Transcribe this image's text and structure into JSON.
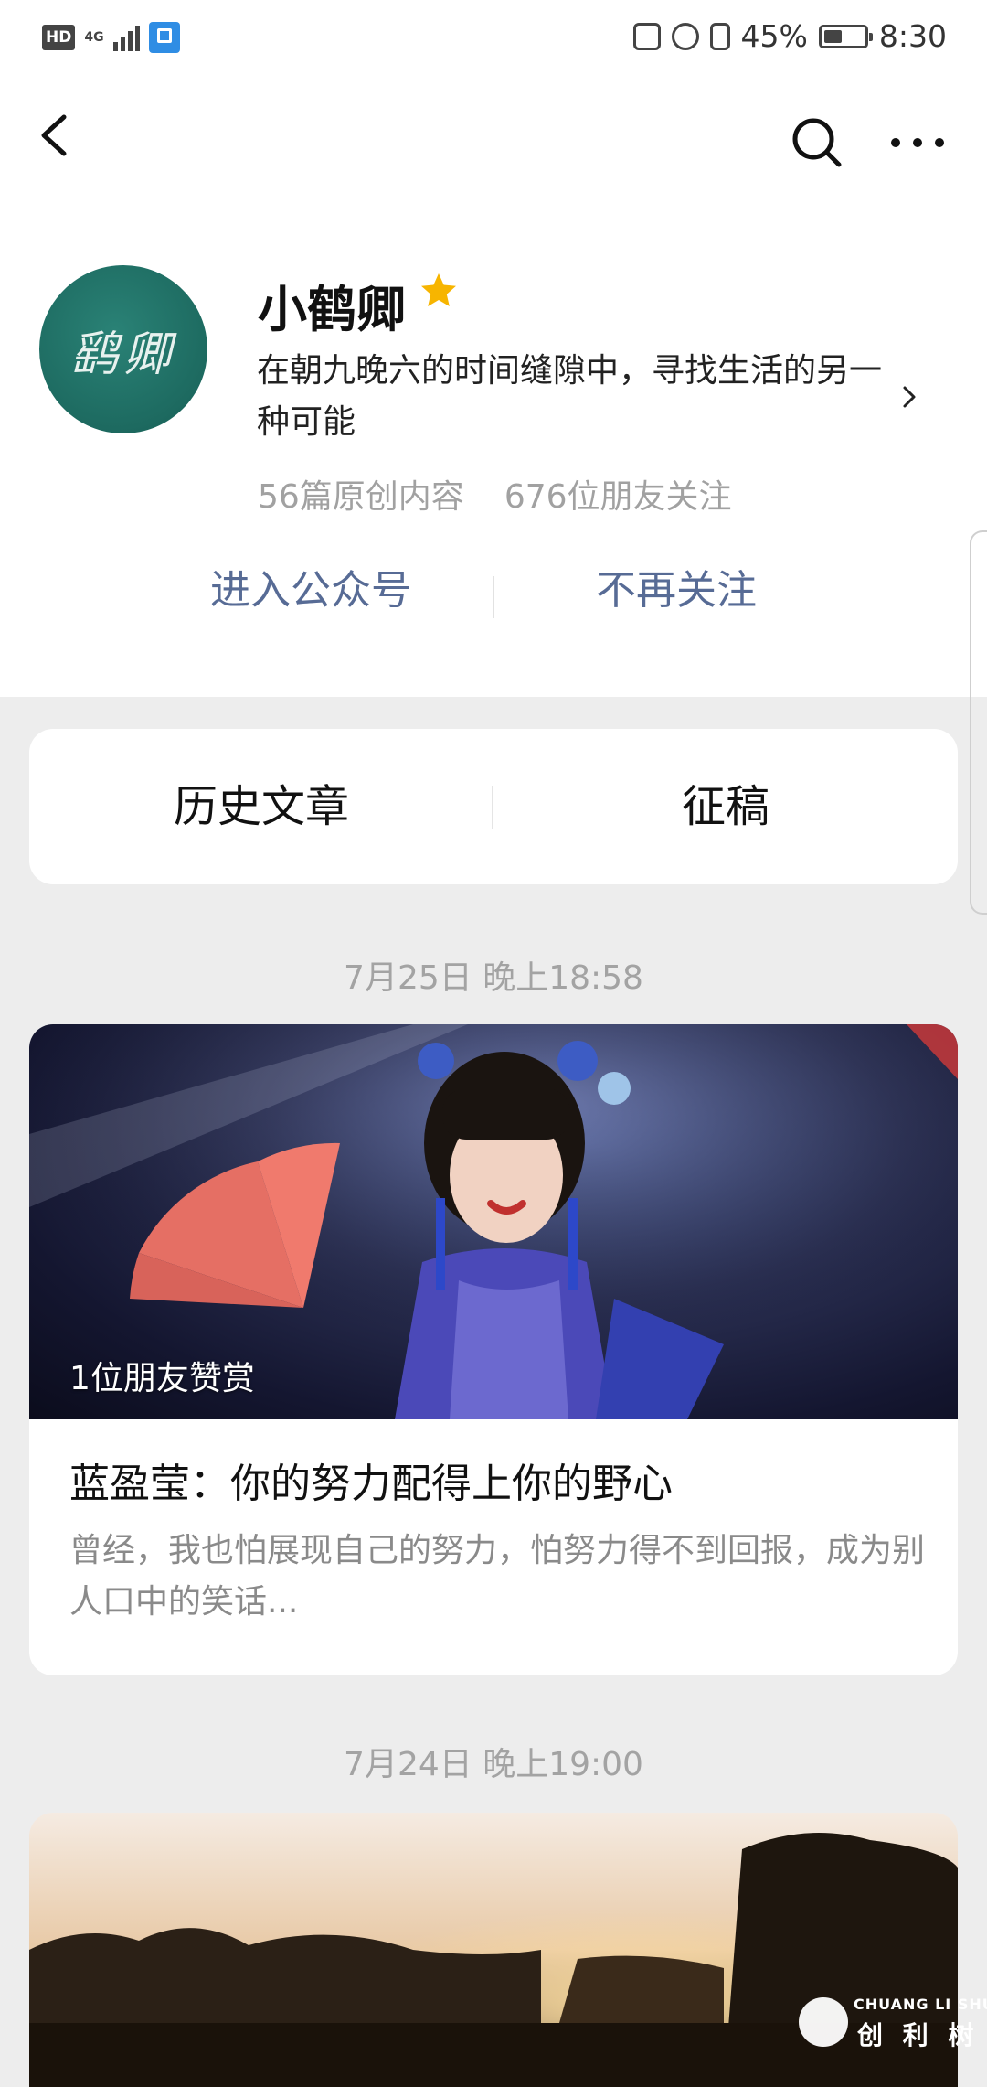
{
  "status_bar": {
    "hd_badge": "HD",
    "network": "4G",
    "battery_percent": "45%",
    "battery_level": 0.45,
    "time": "8:30"
  },
  "nav": {
    "back_icon": "chevron-left-icon",
    "search_icon": "search-icon",
    "more_icon": "more-horizontal-icon"
  },
  "profile": {
    "avatar_text": "鹞卿",
    "name": "小鹤卿",
    "star_color": "#f7b500",
    "description": "在朝九晚六的时间缝隙中，寻找生活的另一种可能",
    "original_count": "56篇原创内容",
    "followers": "676位朋友关注",
    "accent_color": "#576b95"
  },
  "actions": {
    "enter": "进入公众号",
    "unfollow": "不再关注"
  },
  "tabs": {
    "history": "历史文章",
    "submit": "征稿"
  },
  "feed": [
    {
      "date": "7月25日 晚上18:58",
      "cover_label": "1位朋友赞赏",
      "title": "蓝盈莹：你的努力配得上你的野心",
      "summary": "曾经，我也怕展现自己的努力，怕努力得不到回报，成为别人口中的笑话..."
    },
    {
      "date": "7月24日 晚上19:00"
    }
  ],
  "watermark": {
    "en": "CHUANG LI SHU",
    "cn": "创 利 树"
  }
}
